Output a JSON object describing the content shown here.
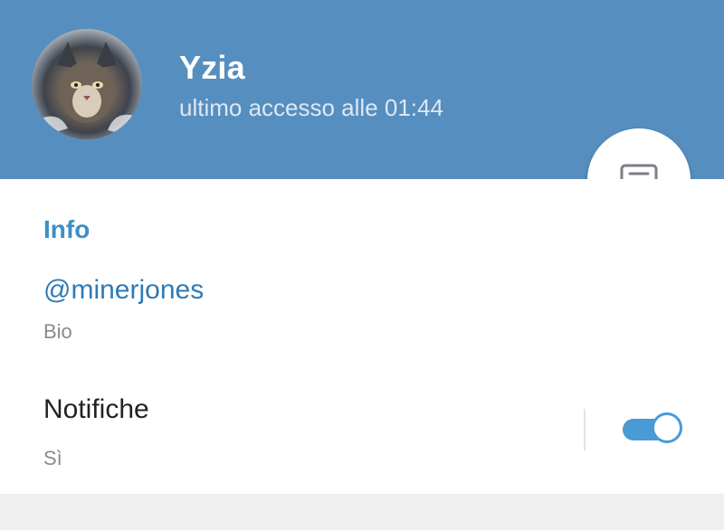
{
  "profile": {
    "name": "Yzia",
    "last_seen": "ultimo accesso alle 01:44",
    "avatar_icon": "cat-photo"
  },
  "actions": {
    "message_icon": "message-icon"
  },
  "info": {
    "section_title": "Info",
    "username": "@minerjones",
    "username_label": "Bio"
  },
  "notifications": {
    "title": "Notifiche",
    "value": "Sì",
    "enabled": true
  },
  "colors": {
    "header": "#568fbf",
    "accent": "#3d8fc6",
    "toggle": "#4a9ad6"
  }
}
